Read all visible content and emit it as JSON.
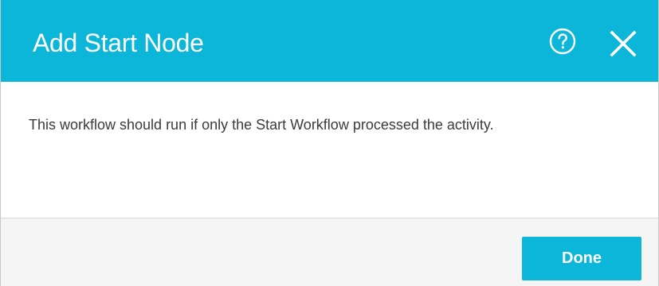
{
  "dialog": {
    "title": "Add Start Node",
    "message": "This workflow should run if only the Start Workflow processed the activity.",
    "done_label": "Done"
  },
  "icons": {
    "help": "help-circle-icon",
    "close": "close-icon"
  },
  "colors": {
    "header": "#0cb6d9",
    "button": "#0cb6d9",
    "footer": "#f5f5f5",
    "text": "#3b3b3b"
  }
}
